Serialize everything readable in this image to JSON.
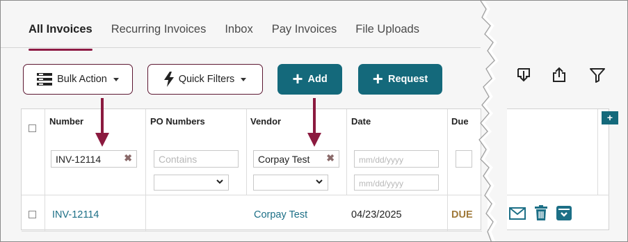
{
  "tabs": [
    {
      "label": "All Invoices",
      "active": true
    },
    {
      "label": "Recurring Invoices",
      "active": false
    },
    {
      "label": "Inbox",
      "active": false
    },
    {
      "label": "Pay Invoices",
      "active": false
    },
    {
      "label": "File Uploads",
      "active": false
    }
  ],
  "toolbar": {
    "bulk_action_label": "Bulk Action",
    "quick_filters_label": "Quick Filters",
    "add_label": "Add",
    "request_label": "Request",
    "icons": [
      "download-icon",
      "upload-icon",
      "filter-icon"
    ]
  },
  "table": {
    "columns": [
      "Number",
      "PO Numbers",
      "Vendor",
      "Date",
      "Due"
    ],
    "add_column_label": "+",
    "filters": {
      "number_value": "INV-12114",
      "po_placeholder": "Contains",
      "vendor_value": "Corpay Test",
      "date_placeholder_1": "mm/dd/yyyy",
      "date_placeholder_2": "mm/dd/yyyy"
    },
    "rows": [
      {
        "number": "INV-12114",
        "po": "",
        "vendor": "Corpay Test",
        "date": "04/23/2025",
        "due": "DUE"
      }
    ]
  },
  "colors": {
    "accent": "#8e1b45",
    "teal": "#14697b",
    "arrow": "#8b1a3f",
    "link": "#1c6f86",
    "due": "#a07a3a"
  }
}
